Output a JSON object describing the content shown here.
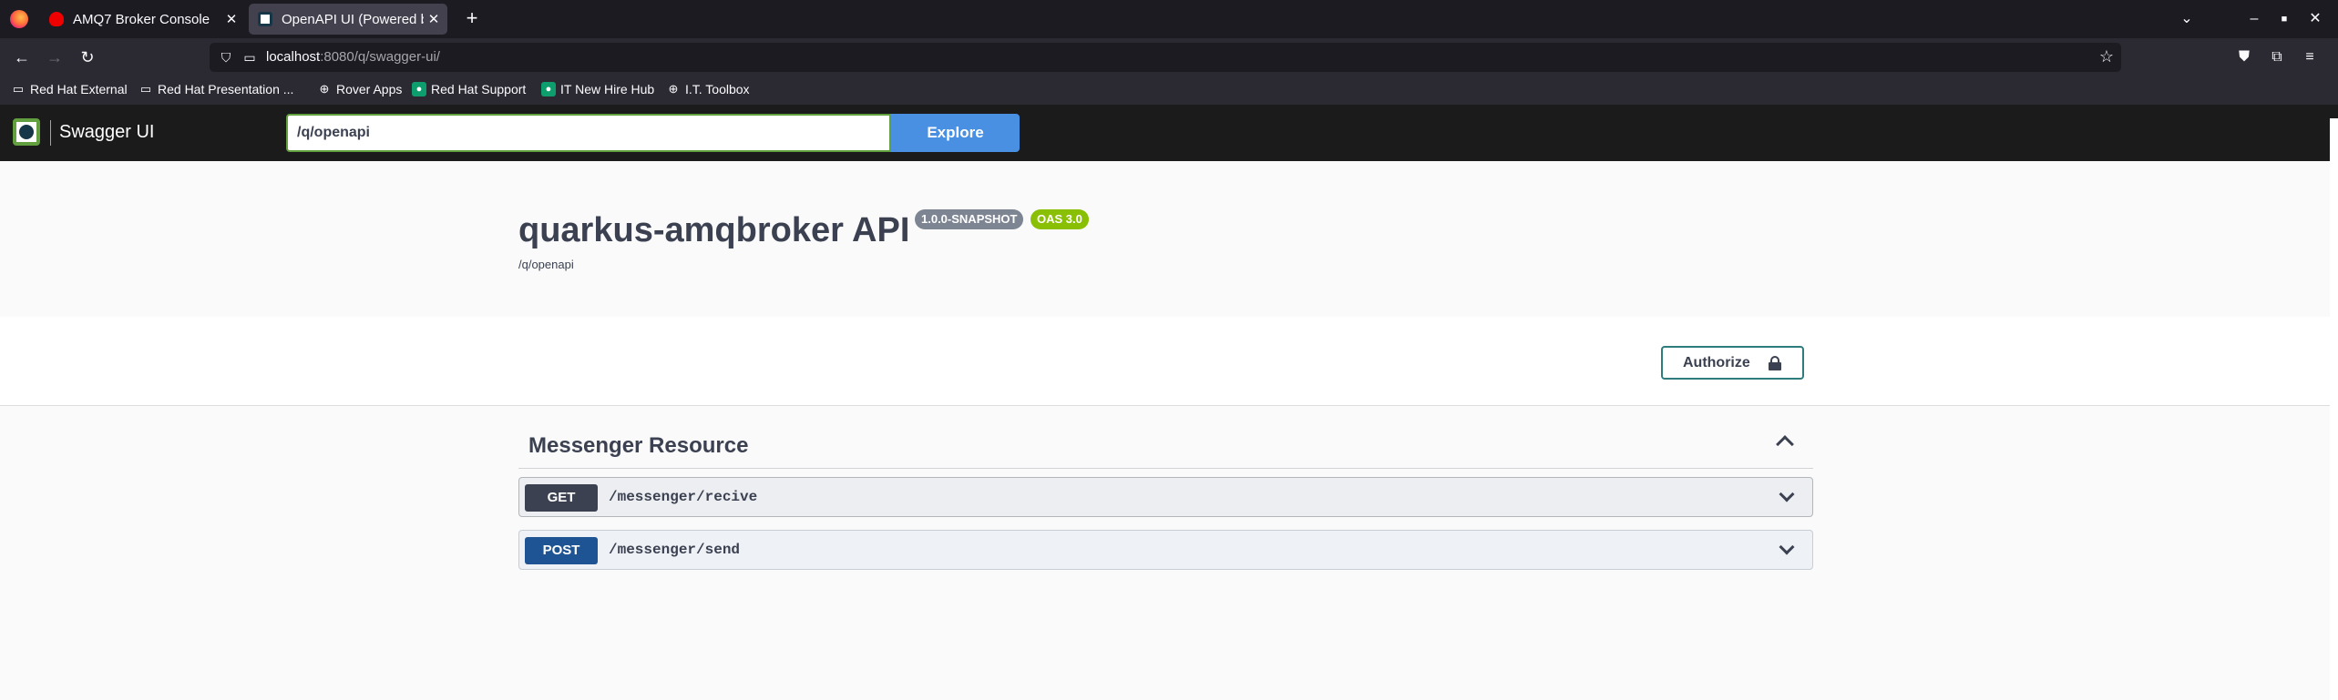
{
  "browser": {
    "tabs": [
      {
        "title": "AMQ7 Broker Console",
        "active": false
      },
      {
        "title": "OpenAPI UI (Powered by S",
        "active": true
      }
    ],
    "new_tab_icon": "plus-icon",
    "url": {
      "host": "localhost",
      "rest": ":8080/q/swagger-ui/"
    },
    "bookmarks": [
      {
        "label": "Red Hat External",
        "icon": "folder-icon"
      },
      {
        "label": "Red Hat Presentation ...",
        "icon": "folder-icon"
      },
      {
        "label": "Rover Apps",
        "icon": "globe-icon"
      },
      {
        "label": "Red Hat Support",
        "icon": "redhat-icon"
      },
      {
        "label": "IT New Hire Hub",
        "icon": "redhat-icon"
      },
      {
        "label": "I.T. Toolbox",
        "icon": "globe-icon"
      }
    ]
  },
  "swagger": {
    "brand": "Swagger UI",
    "spec_url_value": "/q/openapi",
    "explore_label": "Explore",
    "api_title": "quarkus-amqbroker API",
    "version_badge": "1.0.0-SNAPSHOT",
    "oas_badge": "OAS 3.0",
    "spec_link": "/q/openapi",
    "authorize_label": "Authorize",
    "tag": "Messenger Resource",
    "operations": [
      {
        "method": "GET",
        "path": "/messenger/recive"
      },
      {
        "method": "POST",
        "path": "/messenger/send"
      }
    ],
    "colors": {
      "get": "#3b4151",
      "post": "#1f5494",
      "explore": "#4990e2",
      "oas": "#89bf04",
      "version": "#7d8492"
    }
  }
}
